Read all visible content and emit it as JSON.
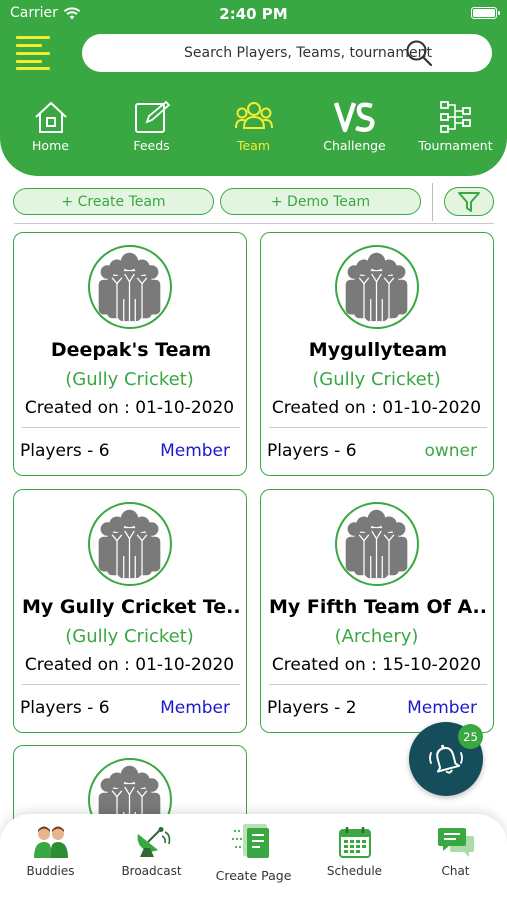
{
  "status_bar": {
    "carrier": "Carrier",
    "time": "2:40 PM"
  },
  "search": {
    "placeholder": "Search Players, Teams, tournament"
  },
  "top_nav": [
    {
      "label": "Home",
      "icon": "home-icon",
      "active": false
    },
    {
      "label": "Feeds",
      "icon": "feeds-icon",
      "active": false
    },
    {
      "label": "Team",
      "icon": "team-icon",
      "active": true
    },
    {
      "label": "Challenge",
      "icon": "vs-icon",
      "active": false
    },
    {
      "label": "Tournament",
      "icon": "bracket-icon",
      "active": false
    }
  ],
  "actions": {
    "create_team": "+ Create Team",
    "demo_team": "+ Demo Team"
  },
  "teams": [
    {
      "name": "Deepak's Team",
      "sport": "(Gully Cricket)",
      "created": "Created on : 01-10-2020",
      "players": "Players - 6",
      "role": "Member"
    },
    {
      "name": "Mygullyteam",
      "sport": "(Gully Cricket)",
      "created": "Created on : 01-10-2020",
      "players": "Players - 6",
      "role": "owner"
    },
    {
      "name": "My Gully Cricket Te...",
      "sport": "(Gully Cricket)",
      "created": "Created on : 01-10-2020",
      "players": "Players - 6",
      "role": "Member"
    },
    {
      "name": "My Fifth Team Of A...",
      "sport": "(Archery)",
      "created": "Created on : 15-10-2020",
      "players": "Players - 2",
      "role": "Member"
    }
  ],
  "notifications": {
    "count": "25"
  },
  "bottom_nav": [
    {
      "label": "Buddies",
      "icon": "buddies-icon"
    },
    {
      "label": "Broadcast",
      "icon": "broadcast-icon"
    },
    {
      "label": "Create Page",
      "icon": "create-page-icon"
    },
    {
      "label": "Schedule",
      "icon": "calendar-icon"
    },
    {
      "label": "Chat",
      "icon": "chat-icon"
    }
  ],
  "colors": {
    "primary": "#3aa842",
    "accent_yellow": "#f4ec2f",
    "member_blue": "#1a1acb",
    "fab": "#164d5a"
  }
}
